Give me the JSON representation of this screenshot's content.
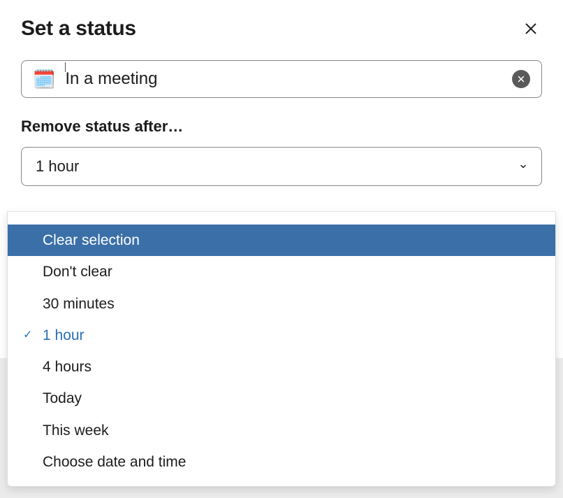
{
  "modal": {
    "title": "Set a status"
  },
  "status": {
    "emoji": "🗓️",
    "text": "In a meeting"
  },
  "remove_after": {
    "label": "Remove status after…",
    "selected": "1 hour"
  },
  "dropdown": {
    "highlighted_index": 0,
    "selected_index": 3,
    "items": [
      "Clear selection",
      "Don't clear",
      "30 minutes",
      "1 hour",
      "4 hours",
      "Today",
      "This week",
      "Choose date and time"
    ]
  }
}
